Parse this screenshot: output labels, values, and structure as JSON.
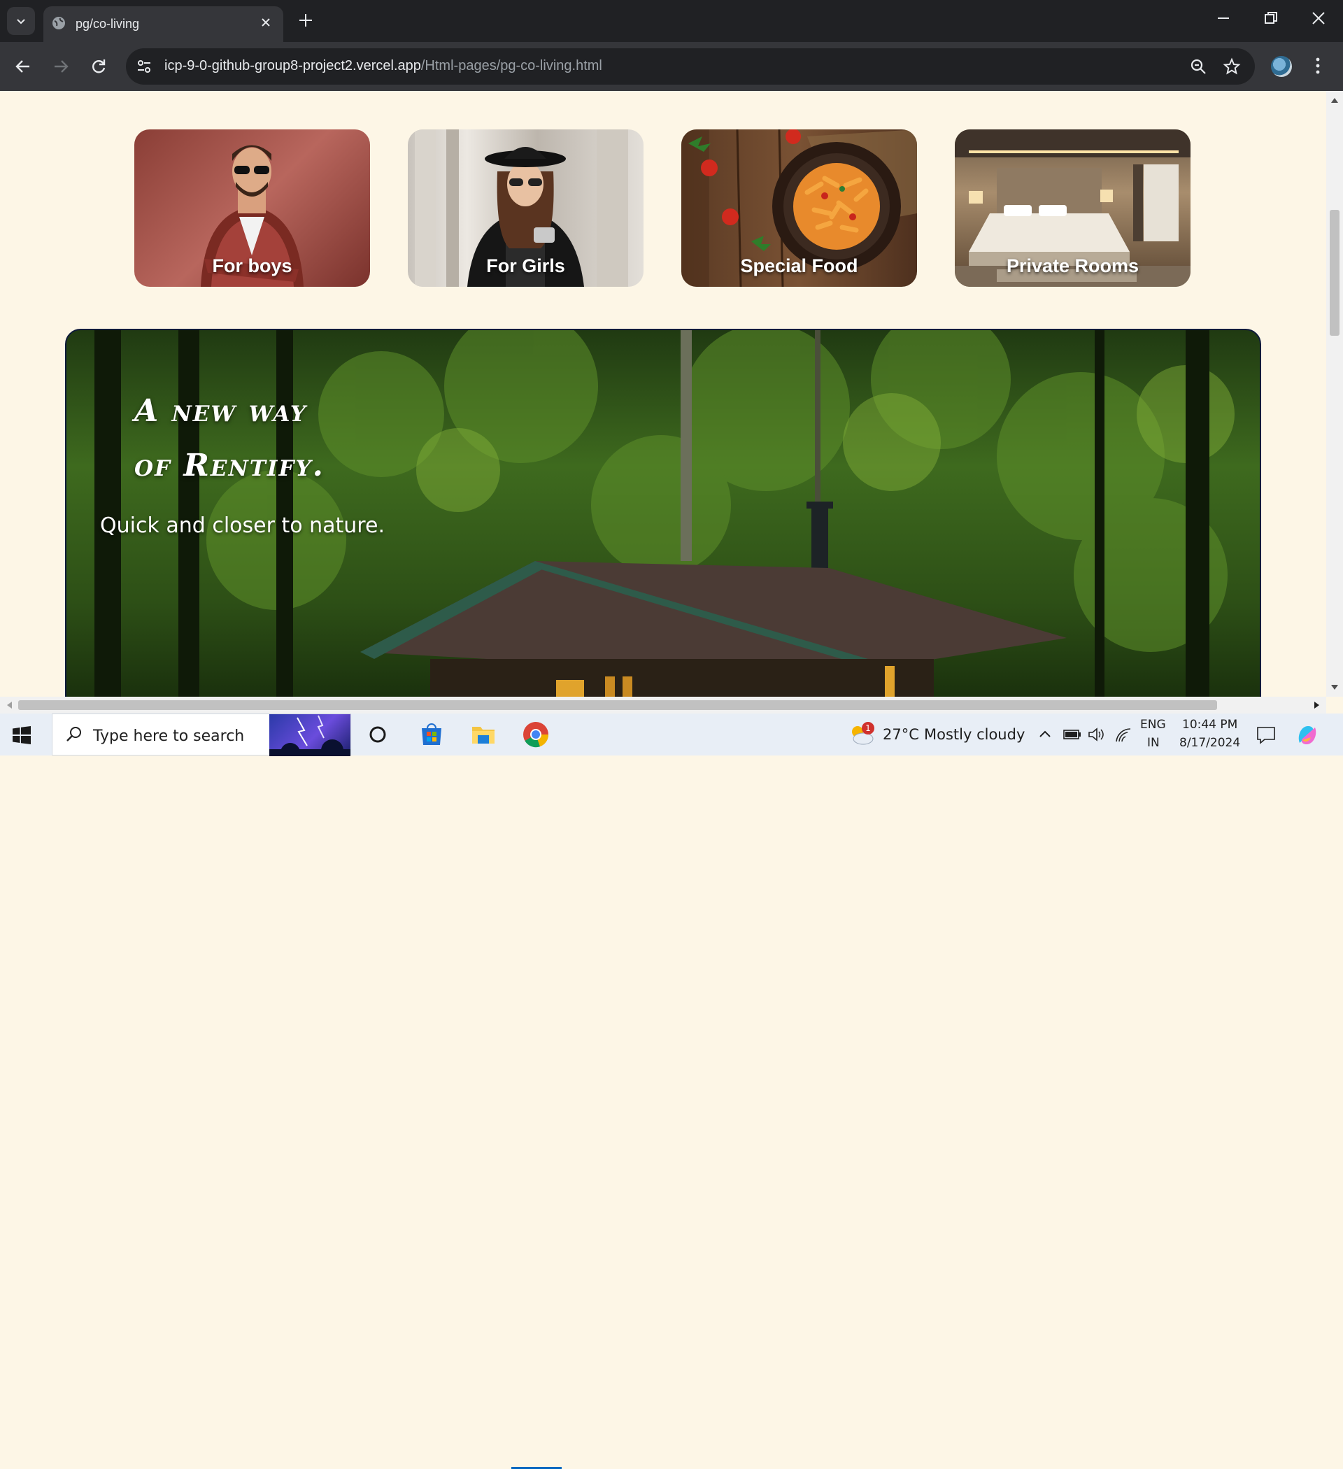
{
  "browser": {
    "tab_title": "pg/co-living",
    "url_host": "icp-9-0-github-group8-project2.vercel.app",
    "url_path": "/Html-pages/pg-co-living.html"
  },
  "page": {
    "cards": [
      {
        "label": "For boys"
      },
      {
        "label": "For Girls"
      },
      {
        "label": "Special Food"
      },
      {
        "label": "Private Rooms"
      }
    ],
    "hero": {
      "line1": "A new way",
      "line2": "of Rentify.",
      "subtitle": "Quick and closer to nature."
    }
  },
  "taskbar": {
    "search_placeholder": "Type here to search",
    "weather_badge": "1",
    "temperature": "27°C",
    "weather_text": "Mostly cloudy",
    "lang_line1": "ENG",
    "lang_line2": "IN",
    "time": "10:44 PM",
    "date": "8/17/2024"
  },
  "colors": {
    "page_bg": "#fdf6e6",
    "chrome_dark": "#202124",
    "chrome_mid": "#35363a",
    "taskbar_accent": "#0067c0"
  }
}
